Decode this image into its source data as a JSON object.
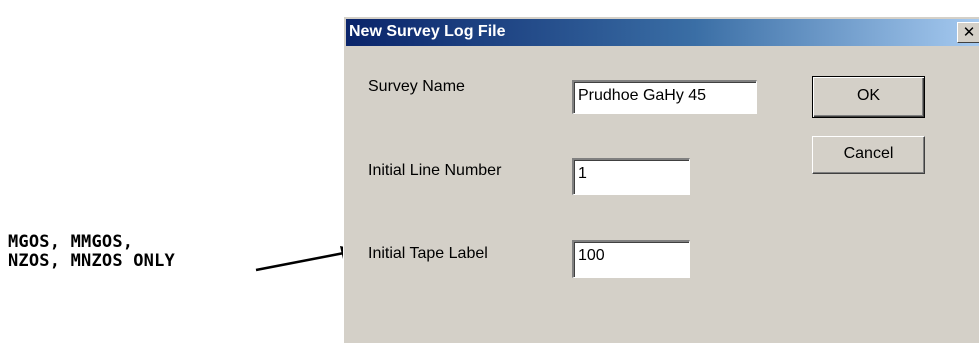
{
  "annotation": {
    "line1": "MGOS, MMGOS,",
    "line2": "NZOS, MNZOS ONLY"
  },
  "dialog": {
    "title": "New Survey Log File",
    "close_glyph": "✕",
    "survey_name": {
      "label": "Survey Name",
      "value": "Prudhoe GaHy 45"
    },
    "initial_line_number": {
      "label": "Initial Line Number",
      "value": "1"
    },
    "initial_tape_label": {
      "label": "Initial Tape Label",
      "value": "100"
    },
    "buttons": {
      "ok": "OK",
      "cancel": "Cancel"
    }
  },
  "colors": {
    "dialog_face": "#d4d0c8",
    "titlebar_start": "#0a246a",
    "titlebar_end": "#a6caf0"
  }
}
